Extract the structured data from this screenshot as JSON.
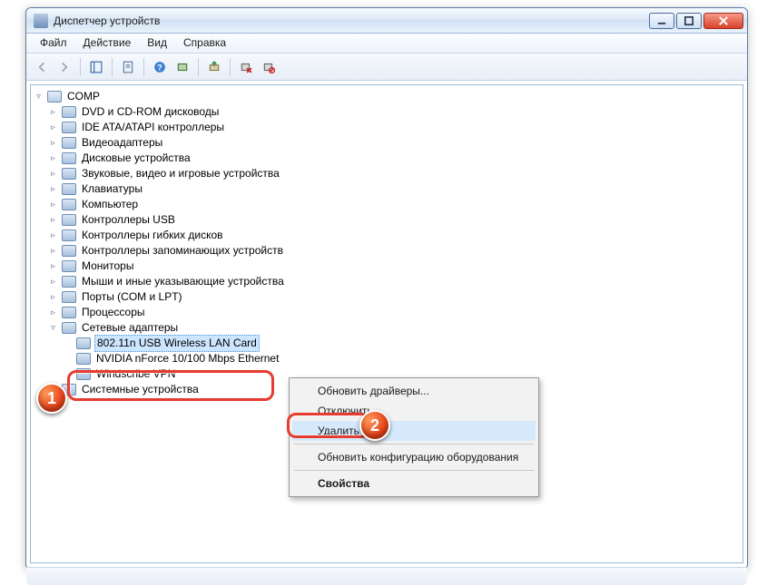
{
  "window": {
    "title": "Диспетчер устройств"
  },
  "menu": {
    "file": "Файл",
    "action": "Действие",
    "view": "Вид",
    "help": "Справка"
  },
  "tree": {
    "root": "COMP",
    "items": [
      "DVD и CD-ROM дисководы",
      "IDE ATA/ATAPI контроллеры",
      "Видеоадаптеры",
      "Дисковые устройства",
      "Звуковые, видео и игровые устройства",
      "Клавиатуры",
      "Компьютер",
      "Контроллеры USB",
      "Контроллеры гибких дисков",
      "Контроллеры запоминающих устройств",
      "Мониторы",
      "Мыши и иные указывающие устройства",
      "Порты (COM и LPT)",
      "Процессоры"
    ],
    "network_label": "Сетевые адаптеры",
    "network_children": [
      "802.11n USB Wireless LAN Card",
      "NVIDIA nForce 10/100 Mbps Ethernet",
      "Windscribe VPN"
    ],
    "last": "Системные устройства"
  },
  "context_menu": {
    "update_drivers": "Обновить драйверы...",
    "disable": "Отключить",
    "delete": "Удалить",
    "scan_hw": "Обновить конфигурацию оборудования",
    "properties": "Свойства"
  },
  "badges": {
    "one": "1",
    "two": "2"
  }
}
